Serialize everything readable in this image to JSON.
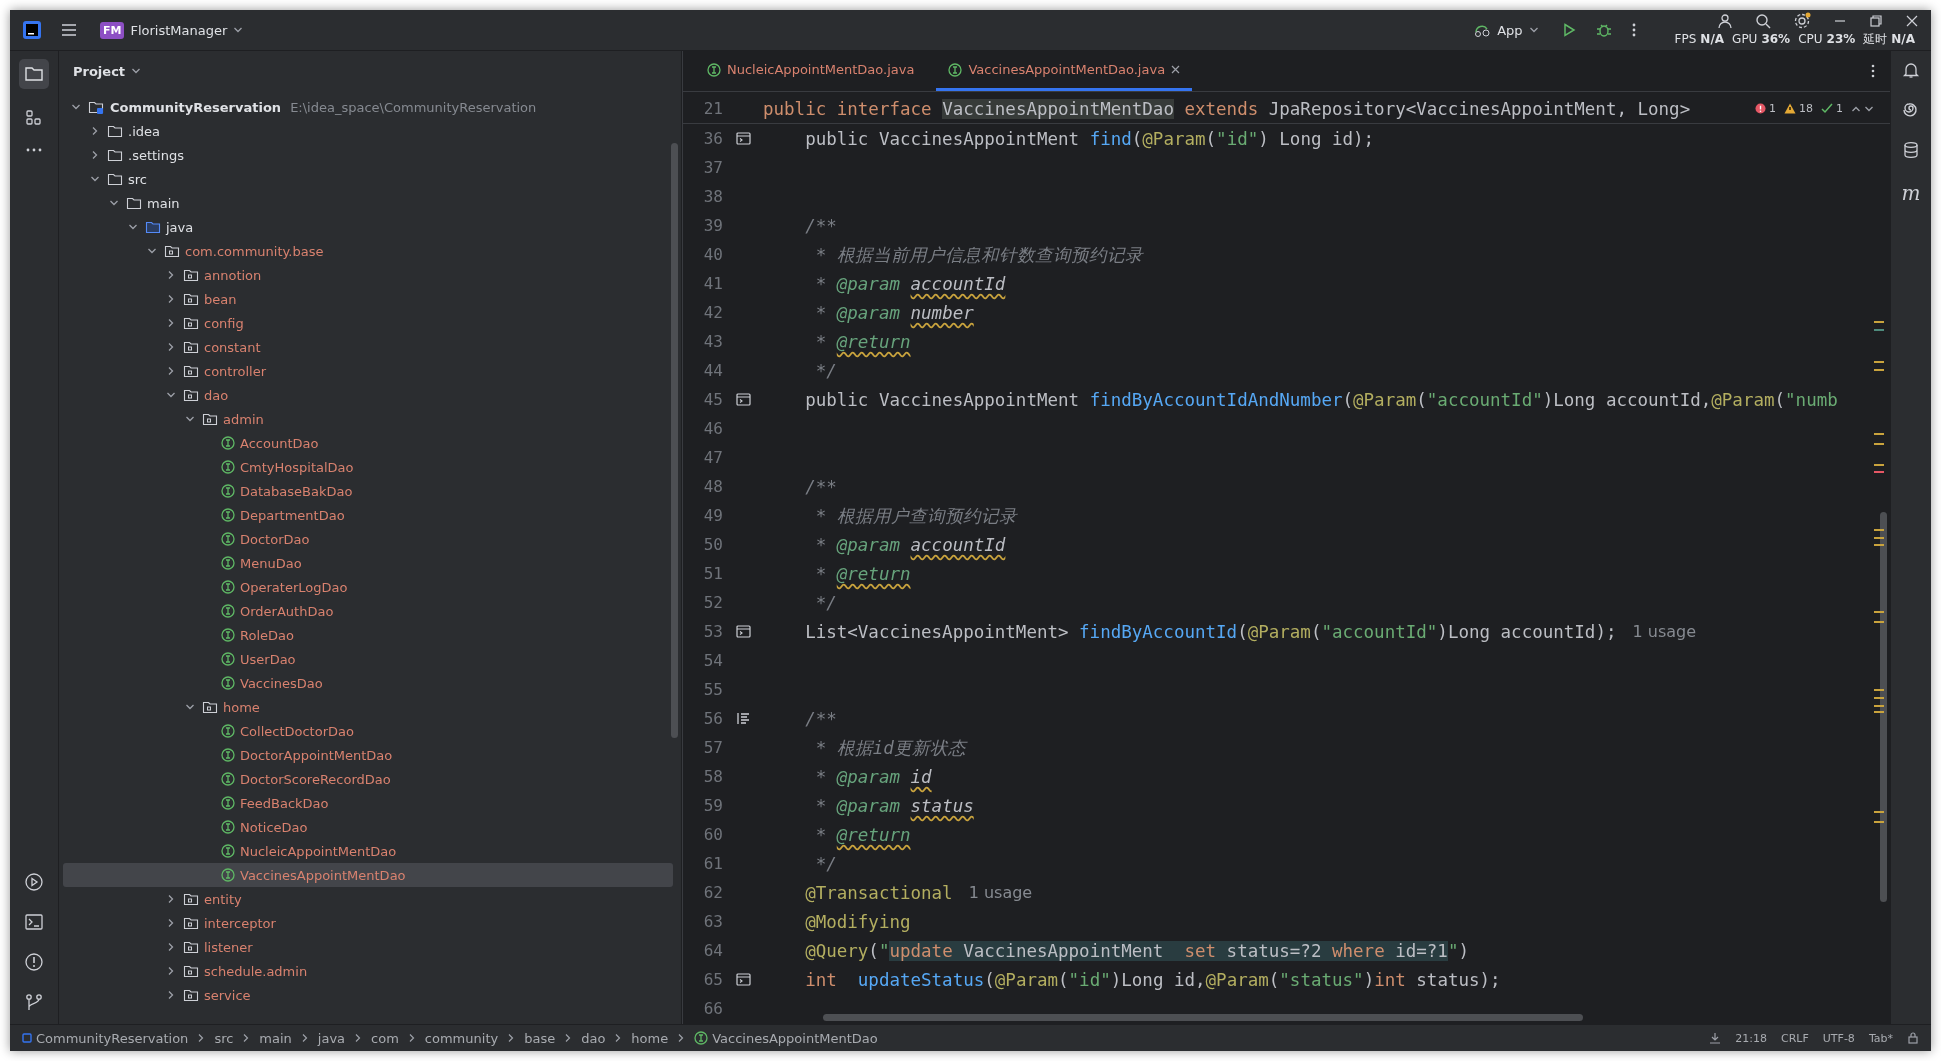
{
  "title_bar": {
    "project_badge": "FM",
    "project_name": "FloristManager",
    "run_config": "App",
    "perf": [
      {
        "label": "FPS",
        "value": "N/A"
      },
      {
        "label": "GPU",
        "value": "36%"
      },
      {
        "label": "CPU",
        "value": "23%"
      },
      {
        "label": "延时",
        "value": "N/A"
      }
    ]
  },
  "project_panel": {
    "title": "Project",
    "tree": [
      {
        "name": "CommunityReservation",
        "path": "E:\\idea_space\\CommunityReservation",
        "kind": "module",
        "color": "#dfe1e5",
        "expanded": true,
        "selected": false,
        "children": [
          {
            "name": ".idea",
            "kind": "folder",
            "color": "#dfe1e5",
            "expanded": false,
            "selected": false
          },
          {
            "name": ".settings",
            "kind": "folder",
            "color": "#dfe1e5",
            "expanded": false,
            "selected": false
          },
          {
            "name": "src",
            "kind": "folder",
            "color": "#dfe1e5",
            "expanded": true,
            "selected": false,
            "children": [
              {
                "name": "main",
                "kind": "folder",
                "color": "#dfe1e5",
                "expanded": true,
                "selected": false,
                "children": [
                  {
                    "name": "java",
                    "kind": "source",
                    "color": "#dfe1e5",
                    "expanded": true,
                    "selected": false,
                    "children": [
                      {
                        "name": "com.community.base",
                        "kind": "package",
                        "color": "#d9826f",
                        "expanded": true,
                        "selected": false,
                        "children": [
                          {
                            "name": "annotion",
                            "kind": "package",
                            "color": "#d9826f",
                            "expanded": false,
                            "selected": false
                          },
                          {
                            "name": "bean",
                            "kind": "package",
                            "color": "#d9826f",
                            "expanded": false,
                            "selected": false
                          },
                          {
                            "name": "config",
                            "kind": "package",
                            "color": "#d9826f",
                            "expanded": false,
                            "selected": false
                          },
                          {
                            "name": "constant",
                            "kind": "package",
                            "color": "#d9826f",
                            "expanded": false,
                            "selected": false
                          },
                          {
                            "name": "controller",
                            "kind": "package",
                            "color": "#d9826f",
                            "expanded": false,
                            "selected": false
                          },
                          {
                            "name": "dao",
                            "kind": "package",
                            "color": "#d9826f",
                            "expanded": true,
                            "selected": false,
                            "children": [
                              {
                                "name": "admin",
                                "kind": "package",
                                "color": "#d9826f",
                                "expanded": true,
                                "selected": false,
                                "children": [
                                  {
                                    "name": "AccountDao",
                                    "kind": "interface",
                                    "color": "#d9826f",
                                    "selected": false
                                  },
                                  {
                                    "name": "CmtyHospitalDao",
                                    "kind": "interface",
                                    "color": "#d9826f",
                                    "selected": false
                                  },
                                  {
                                    "name": "DatabaseBakDao",
                                    "kind": "interface",
                                    "color": "#d9826f",
                                    "selected": false
                                  },
                                  {
                                    "name": "DepartmentDao",
                                    "kind": "interface",
                                    "color": "#d9826f",
                                    "selected": false
                                  },
                                  {
                                    "name": "DoctorDao",
                                    "kind": "interface",
                                    "color": "#d9826f",
                                    "selected": false
                                  },
                                  {
                                    "name": "MenuDao",
                                    "kind": "interface",
                                    "color": "#d9826f",
                                    "selected": false
                                  },
                                  {
                                    "name": "OperaterLogDao",
                                    "kind": "interface",
                                    "color": "#d9826f",
                                    "selected": false
                                  },
                                  {
                                    "name": "OrderAuthDao",
                                    "kind": "interface",
                                    "color": "#d9826f",
                                    "selected": false
                                  },
                                  {
                                    "name": "RoleDao",
                                    "kind": "interface",
                                    "color": "#d9826f",
                                    "selected": false
                                  },
                                  {
                                    "name": "UserDao",
                                    "kind": "interface",
                                    "color": "#d9826f",
                                    "selected": false
                                  },
                                  {
                                    "name": "VaccinesDao",
                                    "kind": "interface",
                                    "color": "#d9826f",
                                    "selected": false
                                  }
                                ]
                              },
                              {
                                "name": "home",
                                "kind": "package",
                                "color": "#d9826f",
                                "expanded": true,
                                "selected": false,
                                "children": [
                                  {
                                    "name": "CollectDoctorDao",
                                    "kind": "interface",
                                    "color": "#d9826f",
                                    "selected": false
                                  },
                                  {
                                    "name": "DoctorAppointMentDao",
                                    "kind": "interface",
                                    "color": "#d9826f",
                                    "selected": false
                                  },
                                  {
                                    "name": "DoctorScoreRecordDao",
                                    "kind": "interface",
                                    "color": "#d9826f",
                                    "selected": false
                                  },
                                  {
                                    "name": "FeedBackDao",
                                    "kind": "interface",
                                    "color": "#d9826f",
                                    "selected": false
                                  },
                                  {
                                    "name": "NoticeDao",
                                    "kind": "interface",
                                    "color": "#d9826f",
                                    "selected": false
                                  },
                                  {
                                    "name": "NucleicAppointMentDao",
                                    "kind": "interface",
                                    "color": "#d9826f",
                                    "selected": false
                                  },
                                  {
                                    "name": "VaccinesAppointMentDao",
                                    "kind": "interface",
                                    "color": "#d9826f",
                                    "selected": true
                                  }
                                ]
                              }
                            ]
                          },
                          {
                            "name": "entity",
                            "kind": "package",
                            "color": "#d9826f",
                            "expanded": false,
                            "selected": false
                          },
                          {
                            "name": "interceptor",
                            "kind": "package",
                            "color": "#d9826f",
                            "expanded": false,
                            "selected": false
                          },
                          {
                            "name": "listener",
                            "kind": "package",
                            "color": "#d9826f",
                            "expanded": false,
                            "selected": false
                          },
                          {
                            "name": "schedule.admin",
                            "kind": "package",
                            "color": "#d9826f",
                            "expanded": false,
                            "selected": false
                          },
                          {
                            "name": "service",
                            "kind": "package",
                            "color": "#d9826f",
                            "expanded": false,
                            "selected": false
                          }
                        ]
                      }
                    ]
                  }
                ]
              }
            ]
          }
        ]
      }
    ]
  },
  "editor": {
    "tabs": [
      {
        "label": "NucleicAppointMentDao.java",
        "selected": false,
        "color": "#d9826f"
      },
      {
        "label": "VaccinesAppointMentDao.java",
        "selected": true,
        "color": "#d9826f"
      }
    ],
    "inspections": {
      "errors": "1",
      "warnings": "18",
      "ok": "1"
    },
    "sticky_line": {
      "number": "21",
      "tokens": [
        {
          "kind": "kw",
          "text": "public interface "
        },
        {
          "kind": "hl",
          "text": "VaccinesAppointMentDao"
        },
        {
          "kind": "kw",
          "text": " extends"
        },
        {
          "kind": "plain",
          "text": " JpaRepository<VaccinesAppointMent, Long>"
        }
      ]
    },
    "lines": [
      {
        "number": "36",
        "gutter": {
          "kind": "impl"
        },
        "tokens": [
          {
            "kind": "plain",
            "text": "    public VaccinesAppointMent "
          },
          {
            "kind": "fn",
            "text": "find"
          },
          {
            "kind": "plain",
            "text": "("
          },
          {
            "kind": "ann",
            "text": "@Param"
          },
          {
            "kind": "plain",
            "text": "("
          },
          {
            "kind": "str",
            "text": "\"id\""
          },
          {
            "kind": "plain",
            "text": ") Long id);"
          }
        ]
      },
      {
        "number": "37"
      },
      {
        "number": "38"
      },
      {
        "number": "39",
        "tokens": [
          {
            "kind": "cmt",
            "text": "    /**"
          }
        ]
      },
      {
        "number": "40",
        "tokens": [
          {
            "kind": "cmt",
            "text": "     * 根据当前用户信息和针数查询预约记录"
          }
        ]
      },
      {
        "number": "41",
        "tokens": [
          {
            "kind": "cmt",
            "text": "     * "
          },
          {
            "kind": "tag",
            "text": "@param "
          },
          {
            "kind": "param",
            "text": "accountId"
          }
        ]
      },
      {
        "number": "42",
        "tokens": [
          {
            "kind": "cmt",
            "text": "     * "
          },
          {
            "kind": "tag",
            "text": "@param "
          },
          {
            "kind": "param",
            "text": "number"
          }
        ]
      },
      {
        "number": "43",
        "tokens": [
          {
            "kind": "cmt",
            "text": "     * "
          },
          {
            "kind": "tagw",
            "text": "@return"
          }
        ]
      },
      {
        "number": "44",
        "tokens": [
          {
            "kind": "cmt",
            "text": "     */"
          }
        ]
      },
      {
        "number": "45",
        "gutter": {
          "kind": "impl"
        },
        "tokens": [
          {
            "kind": "plain",
            "text": "    public VaccinesAppointMent "
          },
          {
            "kind": "fn",
            "text": "findByAccountIdAndNumber"
          },
          {
            "kind": "plain",
            "text": "("
          },
          {
            "kind": "ann",
            "text": "@Param"
          },
          {
            "kind": "plain",
            "text": "("
          },
          {
            "kind": "str",
            "text": "\"accountId\""
          },
          {
            "kind": "plain",
            "text": ")Long accountId,"
          },
          {
            "kind": "ann",
            "text": "@Param"
          },
          {
            "kind": "plain",
            "text": "("
          },
          {
            "kind": "str",
            "text": "\"numb"
          }
        ]
      },
      {
        "number": "46"
      },
      {
        "number": "47"
      },
      {
        "number": "48",
        "tokens": [
          {
            "kind": "cmt",
            "text": "    /**"
          }
        ]
      },
      {
        "number": "49",
        "tokens": [
          {
            "kind": "cmt",
            "text": "     * 根据用户查询预约记录"
          }
        ]
      },
      {
        "number": "50",
        "tokens": [
          {
            "kind": "cmt",
            "text": "     * "
          },
          {
            "kind": "tag",
            "text": "@param "
          },
          {
            "kind": "param",
            "text": "accountId"
          }
        ]
      },
      {
        "number": "51",
        "tokens": [
          {
            "kind": "cmt",
            "text": "     * "
          },
          {
            "kind": "tagw",
            "text": "@return"
          }
        ]
      },
      {
        "number": "52",
        "tokens": [
          {
            "kind": "cmt",
            "text": "     */"
          }
        ]
      },
      {
        "number": "53",
        "gutter": {
          "kind": "impl"
        },
        "tokens": [
          {
            "kind": "plain",
            "text": "    List<VaccinesAppointMent> "
          },
          {
            "kind": "fn",
            "text": "findByAccountId"
          },
          {
            "kind": "plain",
            "text": "("
          },
          {
            "kind": "ann",
            "text": "@Param"
          },
          {
            "kind": "plain",
            "text": "("
          },
          {
            "kind": "str",
            "text": "\"accountId\""
          },
          {
            "kind": "plain",
            "text": ")Long accountId);"
          },
          {
            "kind": "hint",
            "text": "1 usage"
          }
        ]
      },
      {
        "number": "54"
      },
      {
        "number": "55"
      },
      {
        "number": "56",
        "gutter": {
          "kind": "doc"
        },
        "tokens": [
          {
            "kind": "cmt",
            "text": "    /**"
          }
        ]
      },
      {
        "number": "57",
        "tokens": [
          {
            "kind": "cmt",
            "text": "     * 根据id更新状态"
          }
        ]
      },
      {
        "number": "58",
        "tokens": [
          {
            "kind": "cmt",
            "text": "     * "
          },
          {
            "kind": "tag",
            "text": "@param "
          },
          {
            "kind": "param",
            "text": "id"
          }
        ]
      },
      {
        "number": "59",
        "tokens": [
          {
            "kind": "cmt",
            "text": "     * "
          },
          {
            "kind": "tag",
            "text": "@param "
          },
          {
            "kind": "param",
            "text": "status"
          }
        ]
      },
      {
        "number": "60",
        "tokens": [
          {
            "kind": "cmt",
            "text": "     * "
          },
          {
            "kind": "tagw",
            "text": "@return"
          }
        ]
      },
      {
        "number": "61",
        "tokens": [
          {
            "kind": "cmt",
            "text": "     */"
          }
        ]
      },
      {
        "number": "62",
        "tokens": [
          {
            "kind": "ann",
            "text": "    @Transactional"
          },
          {
            "kind": "hint",
            "text": "1 usage"
          }
        ]
      },
      {
        "number": "63",
        "tokens": [
          {
            "kind": "ann",
            "text": "    @Modifying"
          }
        ]
      },
      {
        "number": "64",
        "tokens": [
          {
            "kind": "ann",
            "text": "    @Query"
          },
          {
            "kind": "plain",
            "text": "("
          },
          {
            "kind": "str",
            "text": "\""
          },
          {
            "kind": "sqlkw",
            "text": "update"
          },
          {
            "kind": "sql",
            "text": " VaccinesAppointMent  "
          },
          {
            "kind": "sqlkw",
            "text": "set"
          },
          {
            "kind": "sql",
            "text": " status=?2 "
          },
          {
            "kind": "sqlkw",
            "text": "where"
          },
          {
            "kind": "sql",
            "text": " id=?1"
          },
          {
            "kind": "str",
            "text": "\""
          },
          {
            "kind": "plain",
            "text": ")"
          }
        ]
      },
      {
        "number": "65",
        "gutter": {
          "kind": "impl"
        },
        "tokens": [
          {
            "kind": "kw",
            "text": "    int  "
          },
          {
            "kind": "fn",
            "text": "updateStatus"
          },
          {
            "kind": "plain",
            "text": "("
          },
          {
            "kind": "ann",
            "text": "@Param"
          },
          {
            "kind": "plain",
            "text": "("
          },
          {
            "kind": "str",
            "text": "\"id\""
          },
          {
            "kind": "plain",
            "text": ")Long id,"
          },
          {
            "kind": "ann",
            "text": "@Param"
          },
          {
            "kind": "plain",
            "text": "("
          },
          {
            "kind": "str",
            "text": "\"status\""
          },
          {
            "kind": "plain",
            "text": ")"
          },
          {
            "kind": "kw",
            "text": "int"
          },
          {
            "kind": "plain",
            "text": " status);"
          }
        ]
      },
      {
        "number": "66"
      }
    ]
  },
  "right_toolbar": {
    "maven_label": "m"
  },
  "status_bar": {
    "breadcrumbs": [
      {
        "label": "CommunityReservation",
        "kind": "module"
      },
      {
        "label": "src",
        "kind": "folder"
      },
      {
        "label": "main",
        "kind": "folder"
      },
      {
        "label": "java",
        "kind": "folder"
      },
      {
        "label": "com",
        "kind": "folder"
      },
      {
        "label": "community",
        "kind": "folder"
      },
      {
        "label": "base",
        "kind": "folder"
      },
      {
        "label": "dao",
        "kind": "folder"
      },
      {
        "label": "home",
        "kind": "folder"
      },
      {
        "label": "VaccinesAppointMentDao",
        "kind": "interface"
      }
    ],
    "position": "21:18",
    "line_separator": "CRLF",
    "encoding": "UTF-8",
    "indent": "Tab*"
  }
}
